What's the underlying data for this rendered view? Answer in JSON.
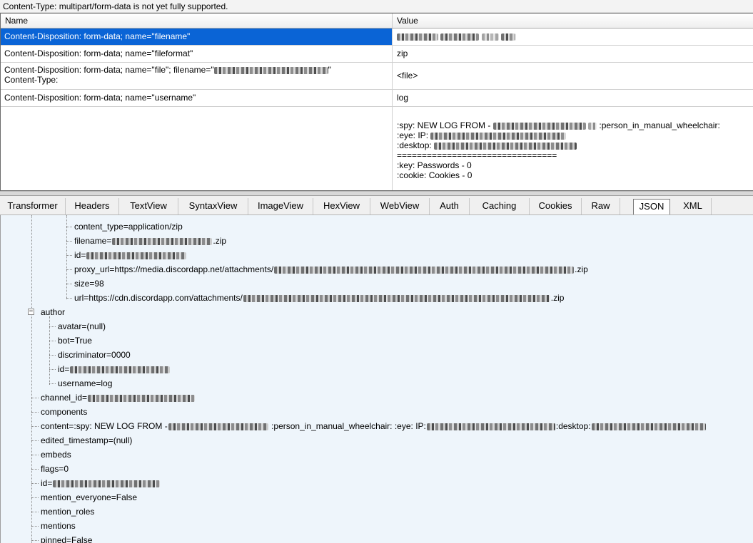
{
  "notice": "Content-Type: multipart/form-data is not yet fully supported.",
  "table": {
    "headers": {
      "name": "Name",
      "value": "Value"
    },
    "rows": [
      {
        "name": "Content-Disposition: form-data; name=\"filename\"",
        "value": ""
      },
      {
        "name": "Content-Disposition: form-data; name=\"fileformat\"",
        "value": "zip"
      },
      {
        "name_line1": "Content-Disposition: form-data; name=\"file\"; filename=\"",
        "name_line2": "Content-Type:",
        "value": "<file>"
      },
      {
        "name": "Content-Disposition: form-data; name=\"username\"",
        "value": "log"
      },
      {
        "name": "",
        "value_lines": {
          "spy_prefix": ":spy: NEW LOG FROM - ",
          "spy_suffix": ":person_in_manual_wheelchair:",
          "eye": ":eye: IP: ",
          "desktop": ":desktop: ",
          "separator": "================================",
          "key": ":key: Passwords - 0",
          "cookie": ":cookie: Cookies - 0"
        }
      }
    ]
  },
  "tabs": [
    {
      "label": "Transformer",
      "active": false
    },
    {
      "label": "Headers",
      "active": false
    },
    {
      "label": "TextView",
      "active": false
    },
    {
      "label": "SyntaxView",
      "active": false
    },
    {
      "label": "ImageView",
      "active": false
    },
    {
      "label": "HexView",
      "active": false
    },
    {
      "label": "WebView",
      "active": false
    },
    {
      "label": "Auth",
      "active": false
    },
    {
      "label": "Caching",
      "active": false
    },
    {
      "label": "Cookies",
      "active": false
    },
    {
      "label": "Raw",
      "active": false
    },
    {
      "label": "JSON",
      "active": true
    },
    {
      "label": "XML",
      "active": false
    }
  ],
  "tree": {
    "attachment": {
      "content_type": "content_type=application/zip",
      "filename_prefix": "filename=",
      "filename_suffix": ".zip",
      "id_prefix": "id=",
      "proxy_url_prefix": "proxy_url=https://media.discordapp.net/attachments/",
      "proxy_url_suffix": ".zip",
      "size": "size=98",
      "url_prefix": "url=https://cdn.discordapp.com/attachments/",
      "url_suffix": ".zip"
    },
    "author": {
      "label": "author",
      "avatar": "avatar=(null)",
      "bot": "bot=True",
      "discriminator": "discriminator=0000",
      "id_prefix": "id=",
      "username": "username=log"
    },
    "channel_id_prefix": "channel_id=",
    "components": "components",
    "content_prefix": "content=:spy: NEW LOG FROM - ",
    "content_mid1": ":person_in_manual_wheelchair: :eye: IP: ",
    "content_mid2": ":desktop: ",
    "edited_timestamp": "edited_timestamp=(null)",
    "embeds": "embeds",
    "flags": "flags=0",
    "id_prefix": "id=",
    "mention_everyone": "mention_everyone=False",
    "mention_roles": "mention_roles",
    "mentions": "mentions",
    "pinned": "pinned=False"
  }
}
